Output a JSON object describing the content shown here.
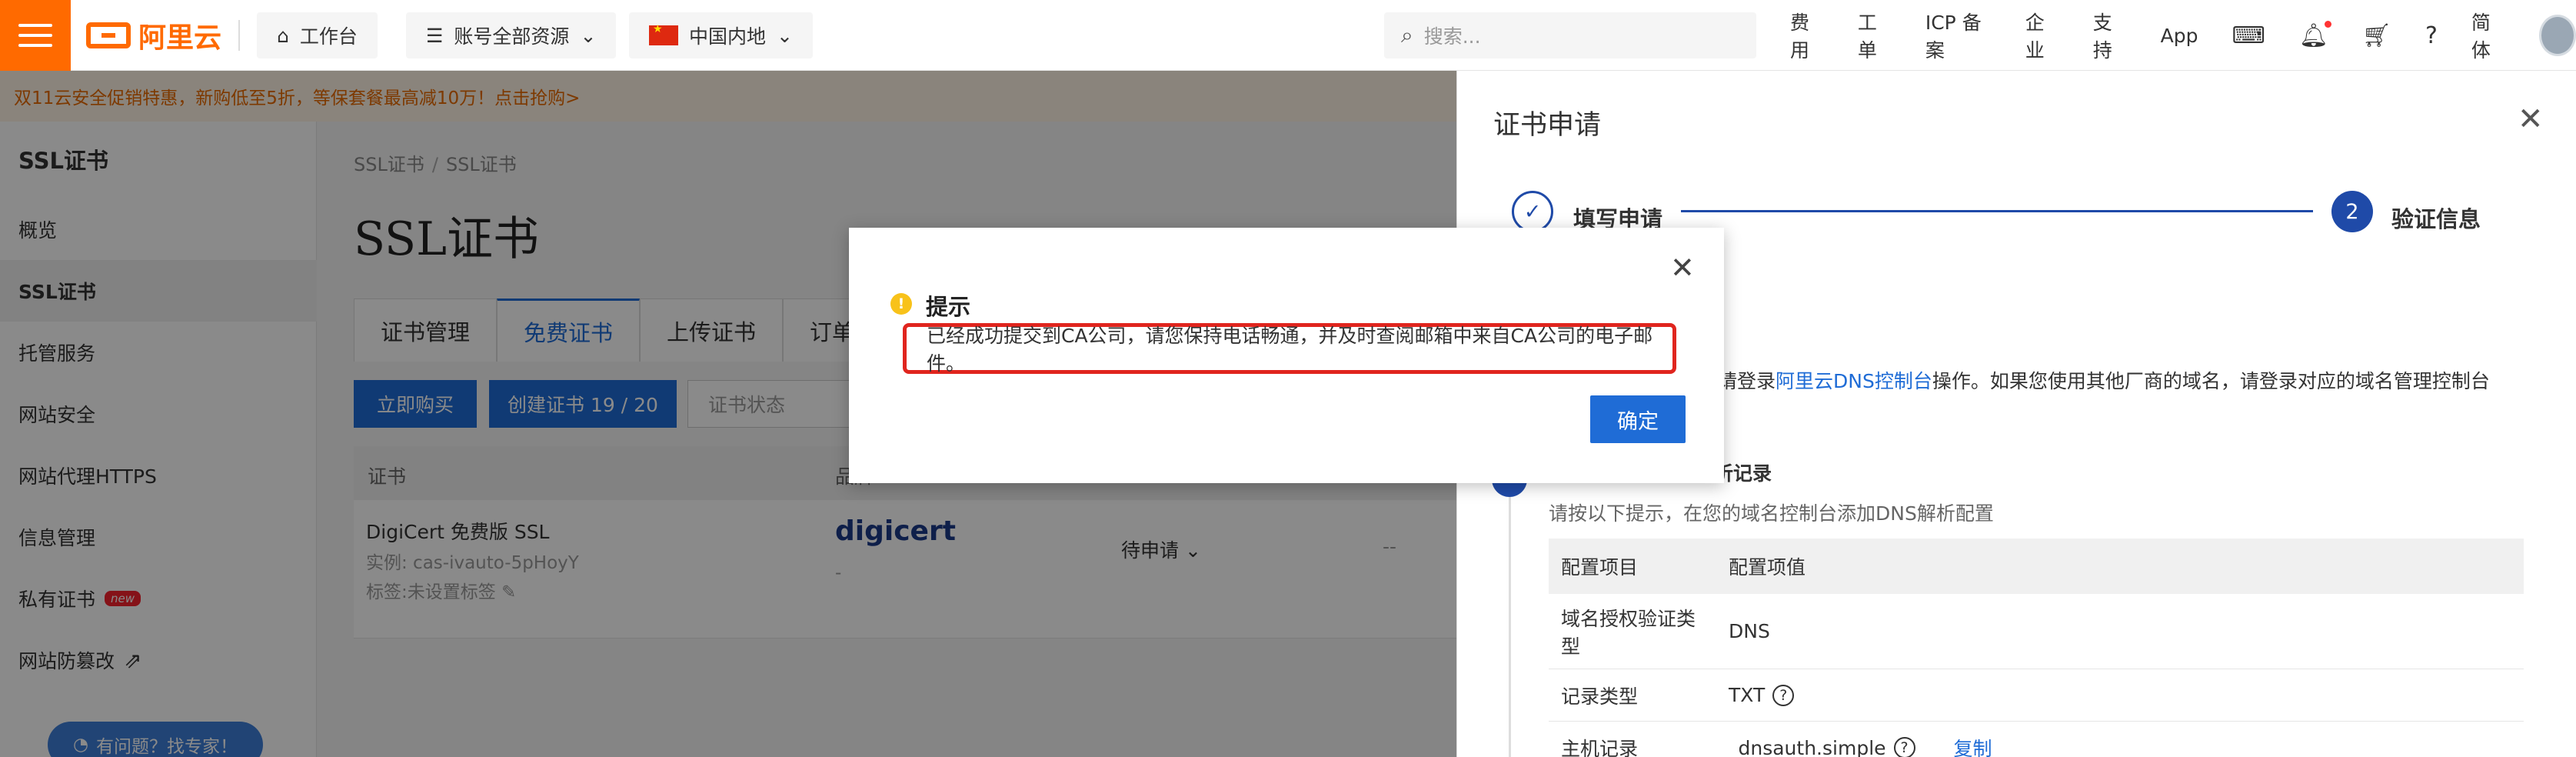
{
  "topbar": {
    "logo_text": "阿里云",
    "workbench": "工作台",
    "resources": "账号全部资源",
    "region": "中国内地",
    "search_placeholder": "搜索...",
    "links": [
      "费用",
      "工单",
      "ICP 备案",
      "企业",
      "支持",
      "App"
    ],
    "lang": "简体"
  },
  "banner": {
    "text": "双11云安全促销特惠，新购低至5折，等保套餐最高减10万！点击抢购>"
  },
  "sidebar": {
    "title": "SSL证书",
    "items": [
      "概览",
      "SSL证书",
      "托管服务",
      "网站安全",
      "网站代理HTTPS",
      "信息管理",
      "私有证书",
      "网站防篡改"
    ],
    "new_badge": "new",
    "help": "有问题？找专家！"
  },
  "main": {
    "breadcrumb": [
      "SSL证书",
      "SSL证书"
    ],
    "title": "SSL证书",
    "tabs": [
      "证书管理",
      "免费证书",
      "上传证书",
      "订单管理"
    ],
    "buy_button": "立即购买",
    "create_button": "创建证书 19 / 20",
    "status_placeholder": "证书状态",
    "table_headers": [
      "证书",
      "品牌"
    ],
    "row": {
      "name": "DigiCert 免费版 SSL",
      "instance": "实例: cas-ivauto-5pHoyY",
      "tags": "标签:未设置标签",
      "brand": "digicert",
      "brand_sub": "-",
      "status": "待申请",
      "extra": "--"
    }
  },
  "drawer": {
    "title": "证书申请",
    "step1": "填写申请",
    "step2_num": "2",
    "step2": "验证信息",
    "hint_prefix": "请登录",
    "hint_link": "阿里云DNS控制台",
    "hint_suffix": "操作。如果您使用其他厂商的域名，请登录对应的域名管理控制台",
    "section_title": "S解析记录",
    "section_sub": "请按以下提示，在您的域名控制台添加DNS解析配置",
    "table": {
      "header": [
        "配置项目",
        "配置项值"
      ],
      "rows": [
        [
          "域名授权验证类型",
          "DNS"
        ],
        [
          "记录类型",
          "TXT"
        ],
        [
          "主机记录",
          "_dnsauth.simple"
        ]
      ],
      "copy": "复制"
    }
  },
  "modal": {
    "title": "提示",
    "message": "已经成功提交到CA公司，请您保持电话畅通，并及时查阅邮箱中来自CA公司的电子邮件。",
    "ok": "确定"
  }
}
